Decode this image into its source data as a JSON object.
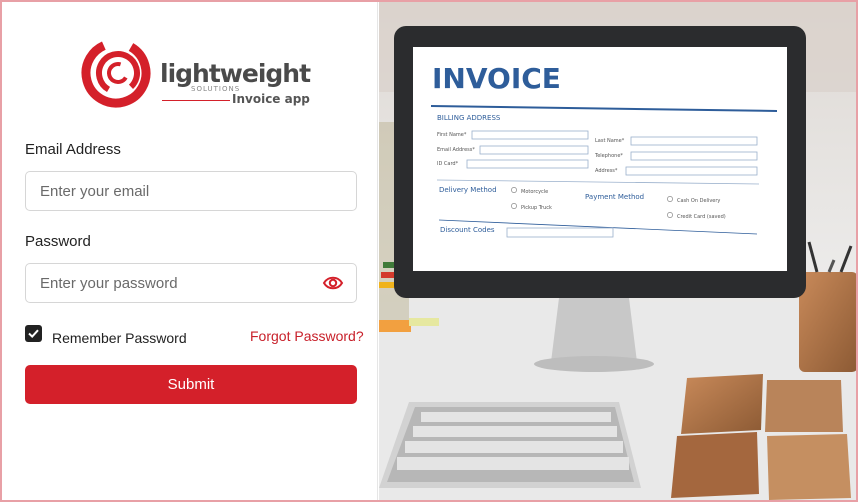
{
  "brand": {
    "logo_word": "lightweight",
    "logo_sub": "SOLUTIONS",
    "app_name": "Invoice app",
    "accent": "#d4202a"
  },
  "form": {
    "email_label": "Email Address",
    "email_placeholder": "Enter your email",
    "email_value": "",
    "password_label": "Password",
    "password_placeholder": "Enter your password",
    "password_value": "",
    "password_icon": "eye-icon",
    "remember_label": "Remember Password",
    "remember_checked": true,
    "forgot_label": "Forgot Password?",
    "submit_label": "Submit"
  },
  "invoice": {
    "title": "INVOICE",
    "billing_heading": "BILLING ADDRESS",
    "first_name": "First Name*",
    "last_name": "Last Name*",
    "email": "Email Address*",
    "telephone": "Telephone*",
    "id_card": "ID Card*",
    "address": "Address*",
    "delivery_method": "Delivery Method",
    "delivery_options": [
      "Motorcycle",
      "Pickup Truck"
    ],
    "payment_method": "Payment Method",
    "payment_options": [
      "Cash On Delivery",
      "Credit Card (saved)"
    ],
    "discount_codes": "Discount Codes"
  }
}
